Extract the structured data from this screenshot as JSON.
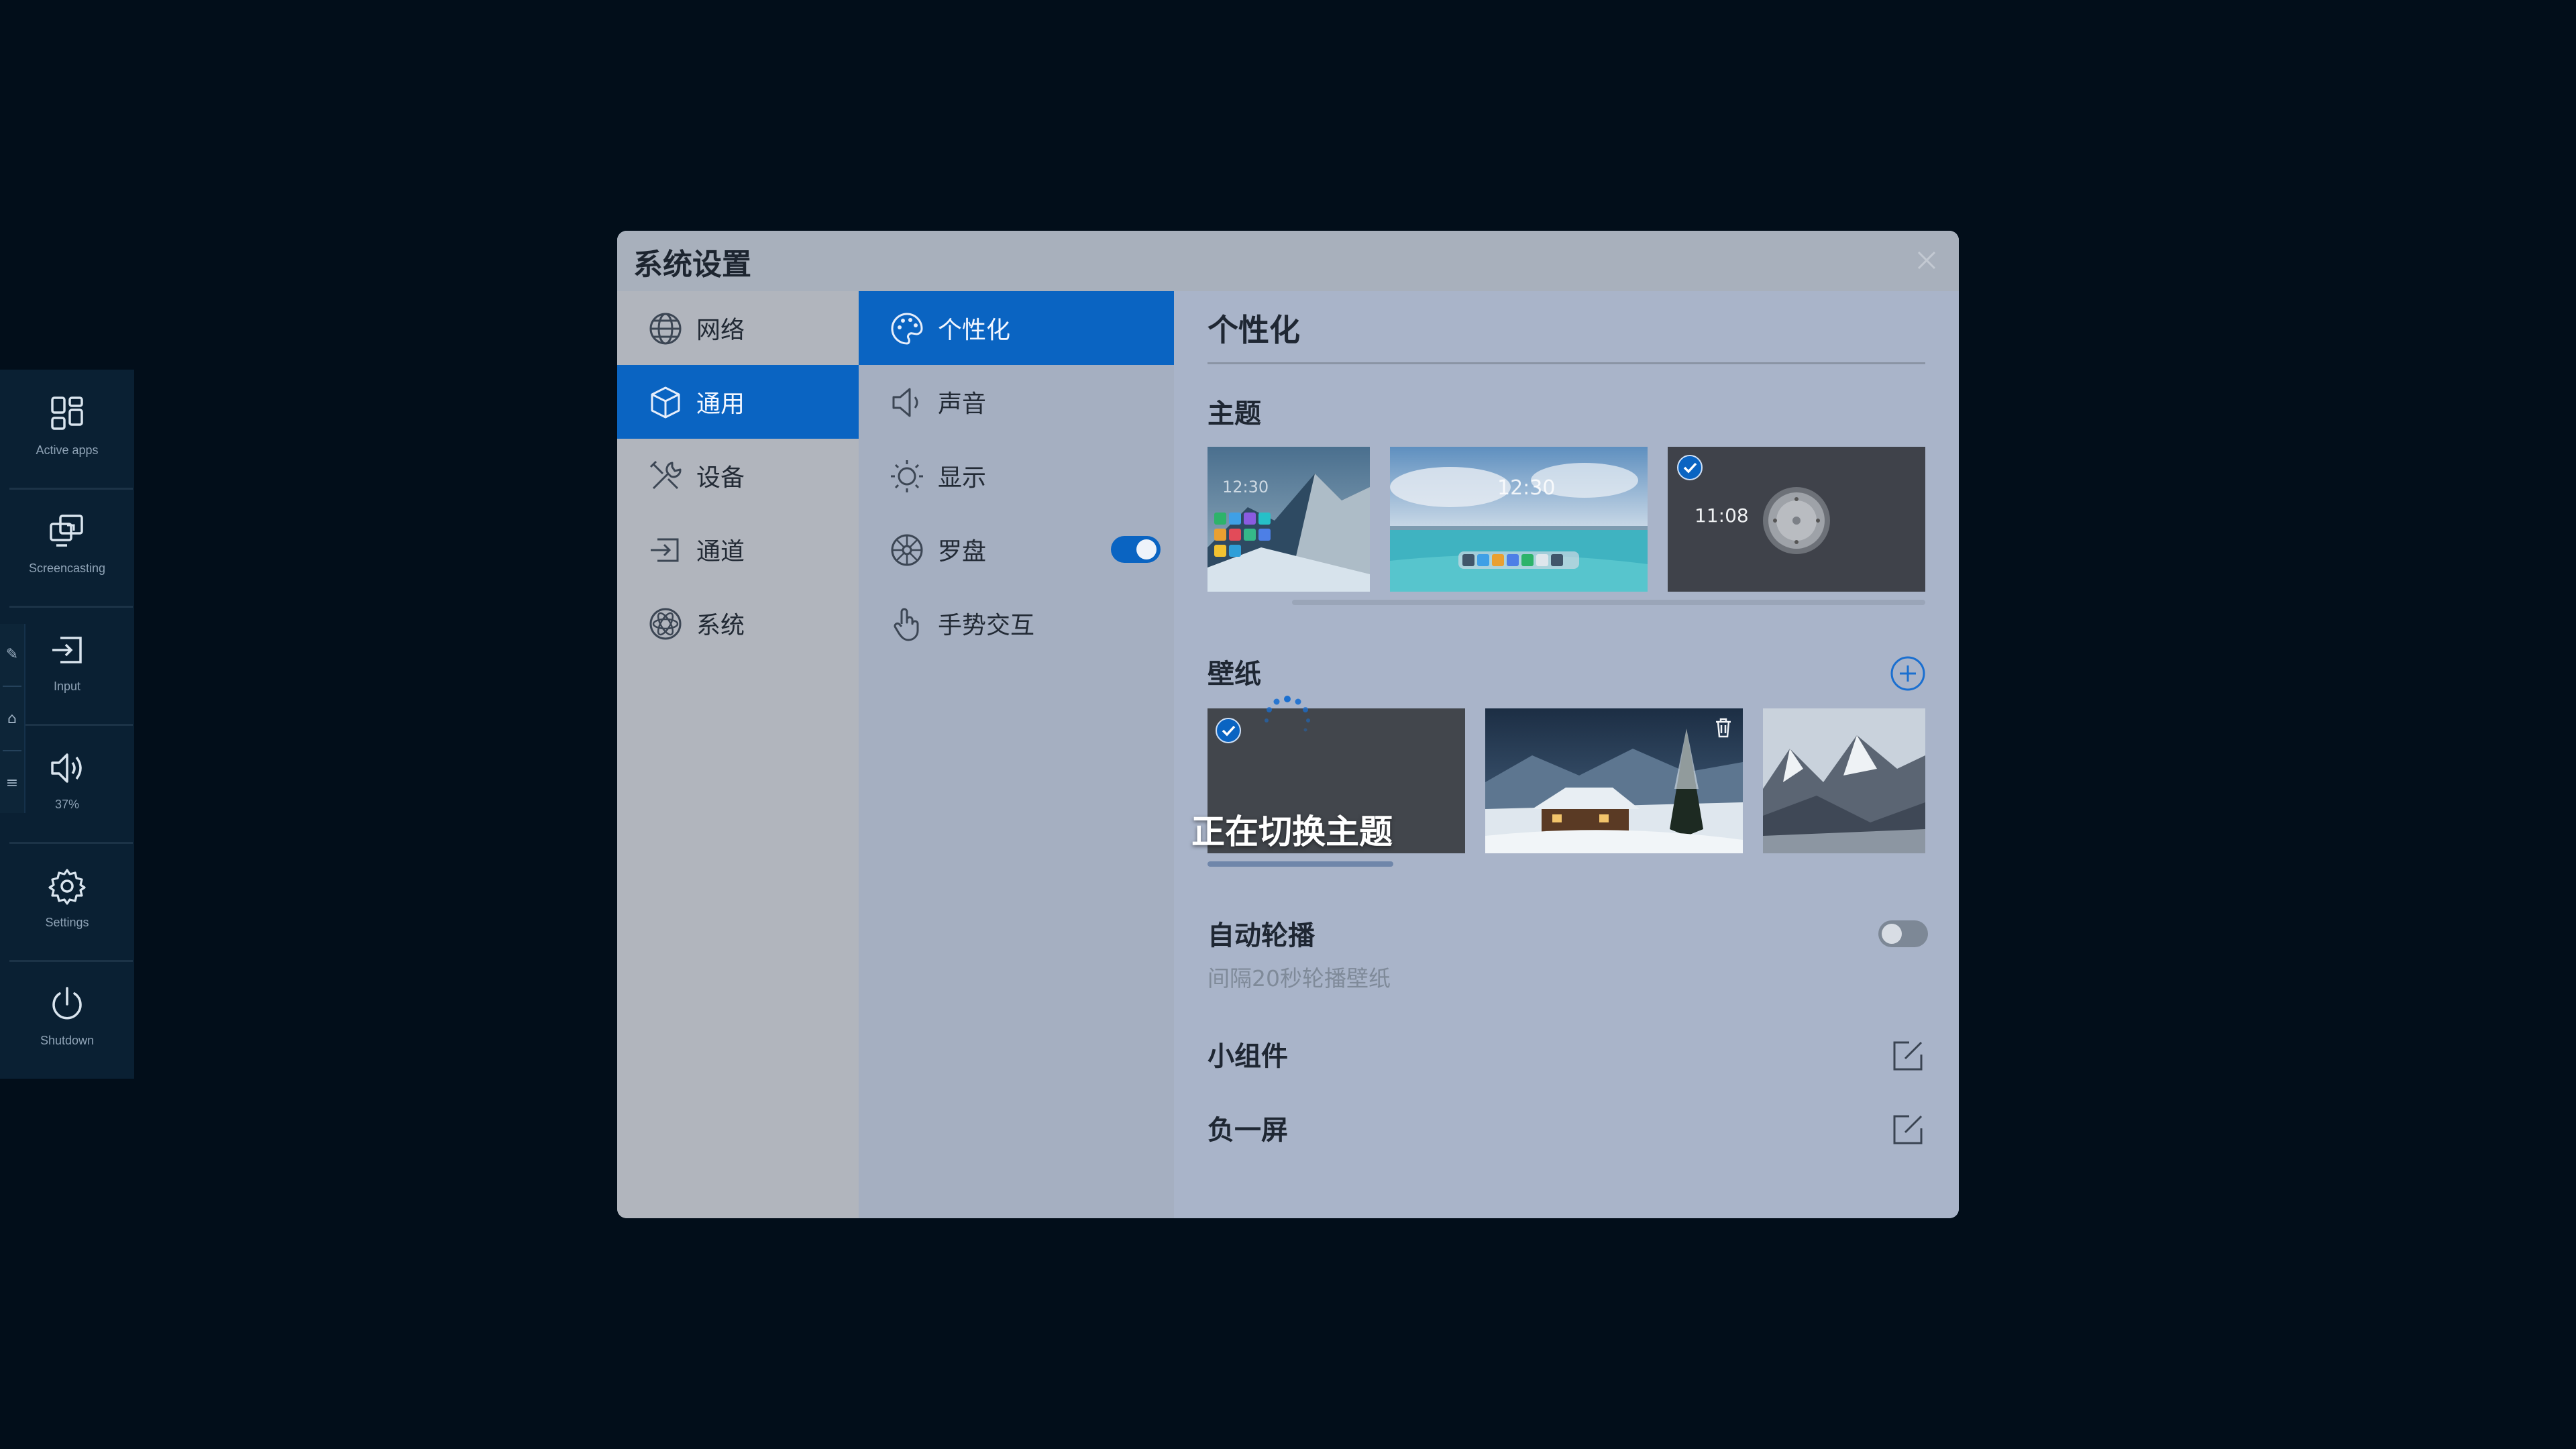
{
  "dock": {
    "items": [
      {
        "label": "Active apps",
        "icon": "apps-grid-icon"
      },
      {
        "label": "Screencasting",
        "icon": "screencast-icon"
      },
      {
        "label": "Input",
        "icon": "input-source-icon"
      },
      {
        "label": "37%",
        "icon": "volume-icon"
      },
      {
        "label": "Settings",
        "icon": "gear-icon"
      },
      {
        "label": "Shutdown",
        "icon": "power-icon"
      }
    ],
    "edge": [
      "✎",
      "⌂",
      "≡"
    ]
  },
  "dialog": {
    "title": "系统设置",
    "nav_primary": [
      {
        "label": "网络",
        "icon": "globe-icon",
        "active": false
      },
      {
        "label": "通用",
        "icon": "cube-icon",
        "active": true
      },
      {
        "label": "设备",
        "icon": "tools-icon",
        "active": false
      },
      {
        "label": "通道",
        "icon": "channel-icon",
        "active": false
      },
      {
        "label": "系统",
        "icon": "atom-icon",
        "active": false
      }
    ],
    "nav_secondary": [
      {
        "label": "个性化",
        "icon": "palette-icon",
        "active": true
      },
      {
        "label": "声音",
        "icon": "speaker-icon",
        "active": false
      },
      {
        "label": "显示",
        "icon": "sun-icon",
        "active": false
      },
      {
        "label": "罗盘",
        "icon": "compass-icon",
        "active": false,
        "toggle": true
      },
      {
        "label": "手势交互",
        "icon": "hand-icon",
        "active": false
      }
    ],
    "panel": {
      "title": "个性化",
      "theme_section": "主题",
      "themes": [
        {
          "clock": "12:30",
          "style": "mountain"
        },
        {
          "clock": "12:30",
          "style": "beach"
        },
        {
          "clock": "11:08",
          "style": "dark-dial",
          "selected": true
        }
      ],
      "wallpaper_section": "壁纸",
      "wallpapers": [
        {
          "style": "dark",
          "selected": true
        },
        {
          "style": "snow-cabin",
          "deletable": true
        },
        {
          "style": "mountains"
        }
      ],
      "auto_rotate": {
        "label": "自动轮播",
        "note": "间隔20秒轮播壁纸",
        "enabled": false
      },
      "widgets_label": "小组件",
      "minus_one_label": "负一屏"
    },
    "overlay": {
      "text": "正在切换主题"
    }
  },
  "colors": {
    "accent": "#0a64c2",
    "background": "#020e1a"
  }
}
